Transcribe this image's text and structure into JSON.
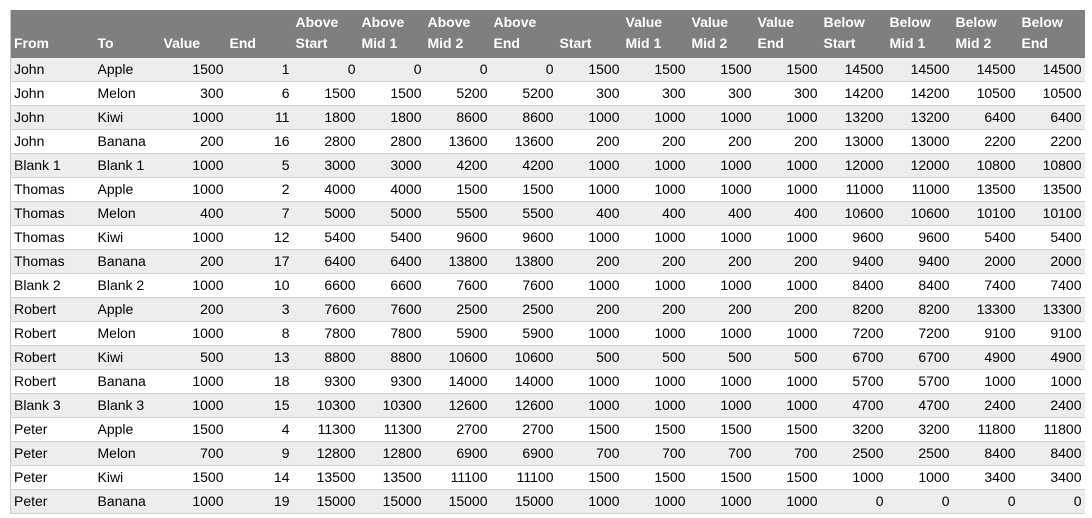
{
  "table": {
    "headers": [
      [
        "",
        "From"
      ],
      [
        "",
        "To"
      ],
      [
        "",
        "Value"
      ],
      [
        "",
        "End"
      ],
      [
        "Above",
        "Start"
      ],
      [
        "Above",
        "Mid 1"
      ],
      [
        "Above",
        "Mid 2"
      ],
      [
        "Above",
        "End"
      ],
      [
        "",
        "Start"
      ],
      [
        "Value",
        "Mid 1"
      ],
      [
        "Value",
        "Mid 2"
      ],
      [
        "Value",
        "End"
      ],
      [
        "Below",
        "Start"
      ],
      [
        "Below",
        "Mid 1"
      ],
      [
        "Below",
        "Mid 2"
      ],
      [
        "Below",
        "End"
      ]
    ],
    "rows": [
      [
        "John",
        "Apple",
        "1500",
        "1",
        "0",
        "0",
        "0",
        "0",
        "1500",
        "1500",
        "1500",
        "1500",
        "14500",
        "14500",
        "14500",
        "14500"
      ],
      [
        "John",
        "Melon",
        "300",
        "6",
        "1500",
        "1500",
        "5200",
        "5200",
        "300",
        "300",
        "300",
        "300",
        "14200",
        "14200",
        "10500",
        "10500"
      ],
      [
        "John",
        "Kiwi",
        "1000",
        "11",
        "1800",
        "1800",
        "8600",
        "8600",
        "1000",
        "1000",
        "1000",
        "1000",
        "13200",
        "13200",
        "6400",
        "6400"
      ],
      [
        "John",
        "Banana",
        "200",
        "16",
        "2800",
        "2800",
        "13600",
        "13600",
        "200",
        "200",
        "200",
        "200",
        "13000",
        "13000",
        "2200",
        "2200"
      ],
      [
        "Blank 1",
        "Blank 1",
        "1000",
        "5",
        "3000",
        "3000",
        "4200",
        "4200",
        "1000",
        "1000",
        "1000",
        "1000",
        "12000",
        "12000",
        "10800",
        "10800"
      ],
      [
        "Thomas",
        "Apple",
        "1000",
        "2",
        "4000",
        "4000",
        "1500",
        "1500",
        "1000",
        "1000",
        "1000",
        "1000",
        "11000",
        "11000",
        "13500",
        "13500"
      ],
      [
        "Thomas",
        "Melon",
        "400",
        "7",
        "5000",
        "5000",
        "5500",
        "5500",
        "400",
        "400",
        "400",
        "400",
        "10600",
        "10600",
        "10100",
        "10100"
      ],
      [
        "Thomas",
        "Kiwi",
        "1000",
        "12",
        "5400",
        "5400",
        "9600",
        "9600",
        "1000",
        "1000",
        "1000",
        "1000",
        "9600",
        "9600",
        "5400",
        "5400"
      ],
      [
        "Thomas",
        "Banana",
        "200",
        "17",
        "6400",
        "6400",
        "13800",
        "13800",
        "200",
        "200",
        "200",
        "200",
        "9400",
        "9400",
        "2000",
        "2000"
      ],
      [
        "Blank 2",
        "Blank 2",
        "1000",
        "10",
        "6600",
        "6600",
        "7600",
        "7600",
        "1000",
        "1000",
        "1000",
        "1000",
        "8400",
        "8400",
        "7400",
        "7400"
      ],
      [
        "Robert",
        "Apple",
        "200",
        "3",
        "7600",
        "7600",
        "2500",
        "2500",
        "200",
        "200",
        "200",
        "200",
        "8200",
        "8200",
        "13300",
        "13300"
      ],
      [
        "Robert",
        "Melon",
        "1000",
        "8",
        "7800",
        "7800",
        "5900",
        "5900",
        "1000",
        "1000",
        "1000",
        "1000",
        "7200",
        "7200",
        "9100",
        "9100"
      ],
      [
        "Robert",
        "Kiwi",
        "500",
        "13",
        "8800",
        "8800",
        "10600",
        "10600",
        "500",
        "500",
        "500",
        "500",
        "6700",
        "6700",
        "4900",
        "4900"
      ],
      [
        "Robert",
        "Banana",
        "1000",
        "18",
        "9300",
        "9300",
        "14000",
        "14000",
        "1000",
        "1000",
        "1000",
        "1000",
        "5700",
        "5700",
        "1000",
        "1000"
      ],
      [
        "Blank 3",
        "Blank 3",
        "1000",
        "15",
        "10300",
        "10300",
        "12600",
        "12600",
        "1000",
        "1000",
        "1000",
        "1000",
        "4700",
        "4700",
        "2400",
        "2400"
      ],
      [
        "Peter",
        "Apple",
        "1500",
        "4",
        "11300",
        "11300",
        "2700",
        "2700",
        "1500",
        "1500",
        "1500",
        "1500",
        "3200",
        "3200",
        "11800",
        "11800"
      ],
      [
        "Peter",
        "Melon",
        "700",
        "9",
        "12800",
        "12800",
        "6900",
        "6900",
        "700",
        "700",
        "700",
        "700",
        "2500",
        "2500",
        "8400",
        "8400"
      ],
      [
        "Peter",
        "Kiwi",
        "1500",
        "14",
        "13500",
        "13500",
        "11100",
        "11100",
        "1500",
        "1500",
        "1500",
        "1500",
        "1000",
        "1000",
        "3400",
        "3400"
      ],
      [
        "Peter",
        "Banana",
        "1000",
        "19",
        "15000",
        "15000",
        "15000",
        "15000",
        "1000",
        "1000",
        "1000",
        "1000",
        "0",
        "0",
        "0",
        "0"
      ]
    ]
  },
  "colors": {
    "header_bg": "#7f7f7f",
    "band_row": "#ededed",
    "header_text": "#ffffff"
  }
}
